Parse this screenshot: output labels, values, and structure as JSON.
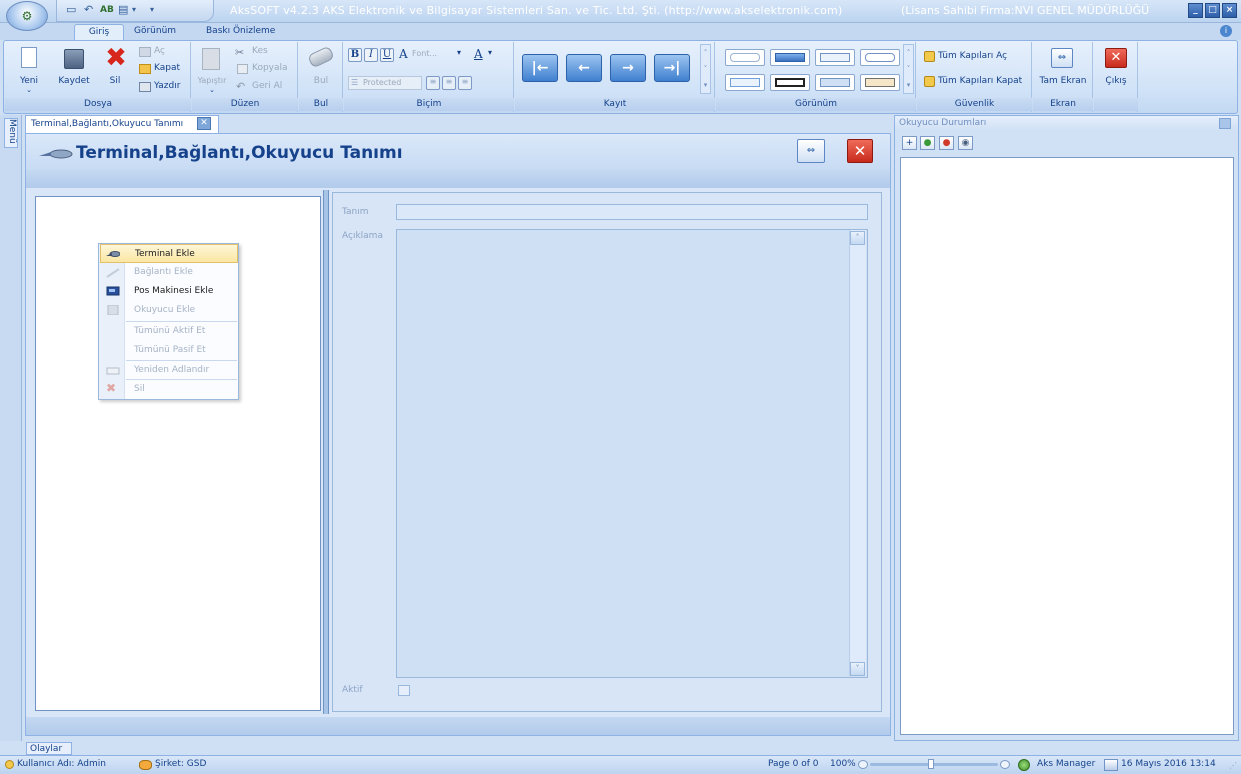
{
  "window": {
    "app_title": "AksSOFT v4.2.3 AKS Elektronik ve Bilgisayar Sistemleri San. ve Tic. Ltd. Şti. (http://www.akselektronik.com)",
    "license": "(Lisans Sahibi Firma:NVI GENEL MÜDÜRLÜĞÜ",
    "min_label": "_",
    "max_label": "□",
    "close_label": "×"
  },
  "ribbon_tabs": [
    {
      "label": "Giriş"
    },
    {
      "label": "Görünüm"
    },
    {
      "label": "Baskı Önizleme"
    }
  ],
  "ribbon": {
    "dosya": {
      "label": "Dosya",
      "yeni": "Yeni",
      "kaydet": "Kaydet",
      "sil": "Sil",
      "ac": "Aç",
      "kapat": "Kapat",
      "yazdir": "Yazdır"
    },
    "duzen": {
      "label": "Düzen",
      "yapistir": "Yapıştır",
      "kes": "Kes",
      "kopyala": "Kopyala",
      "geri_al": "Geri Al"
    },
    "bul": {
      "label": "Bul",
      "btn": "Bul"
    },
    "bicim": {
      "label": "Biçim",
      "bold": "B",
      "italic": "I",
      "underline": "U",
      "font_letter": "A",
      "font": "Font...",
      "protected": "Protected"
    },
    "kayit": {
      "label": "Kayıt"
    },
    "gorunum": {
      "label": "Görünüm"
    },
    "guvenlik": {
      "label": "Güvenlik",
      "tum_ac": "Tüm Kapıları Aç",
      "tum_kapat": "Tüm Kapıları Kapat"
    },
    "ekran": {
      "label": "Ekran",
      "tam_ekran": "Tam Ekran"
    },
    "cikis": {
      "cikis": "Çıkış"
    }
  },
  "side_menu": {
    "label": "Menü"
  },
  "doc_tab": {
    "label": "Terminal,Bağlantı,Okuyucu Tanımı"
  },
  "form": {
    "title": "Terminal,Bağlantı,Okuyucu Tanımı",
    "close_label": "✕",
    "tanim_label": "Tanım",
    "aciklama_label": "Açıklama",
    "aktif_label": "Aktif"
  },
  "context_menu": [
    {
      "label": "Terminal Ekle",
      "enabled": true,
      "icon": "terminal-icon"
    },
    {
      "label": "Bağlantı Ekle",
      "enabled": false,
      "icon": "connection-icon"
    },
    {
      "label": "Pos Makinesi Ekle",
      "enabled": true,
      "icon": "pos-icon"
    },
    {
      "label": "Okuyucu Ekle",
      "enabled": false,
      "icon": "reader-icon"
    },
    {
      "label": "Tümünü Aktif Et",
      "enabled": false
    },
    {
      "label": "Tümünü Pasif Et",
      "enabled": false
    },
    {
      "label": "Yeniden Adlandır",
      "enabled": false,
      "icon": "rename-icon"
    },
    {
      "label": "Sil",
      "enabled": false,
      "icon": "delete-icon"
    }
  ],
  "right_panel": {
    "title": "Okuyucu Durumları"
  },
  "bottom_tab": {
    "label": "Olaylar"
  },
  "status": {
    "user": "Kullanıcı Adı:  Admin",
    "company": "Şirket:  GSD",
    "page": "Page 0 of 0",
    "zoom": "100%",
    "manager": "Aks Manager",
    "datetime": "16 Mayıs 2016 13:14"
  },
  "colors": {
    "accent": "#15428b",
    "ribbon_bg": "#d0e2f7",
    "close_red": "#c72b1c"
  }
}
